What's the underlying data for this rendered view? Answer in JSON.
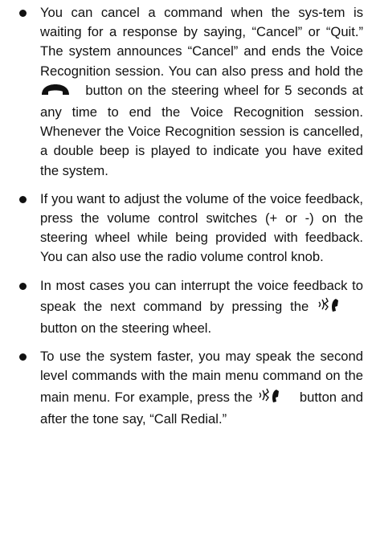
{
  "bullets": [
    {
      "a": "You can cancel a command when the sys-tem is waiting for a response by saying, “Cancel” or “Quit.” The system announces “Cancel” and ends the Voice Recognition session. You can also press and hold the",
      "icon": "phone-hang-up-icon",
      "b": "button on the steering wheel for 5 seconds at any time to end the Voice Recognition session. Whenever the Voice Recognition session is cancelled, a double beep is played to indicate you have exited the system."
    },
    {
      "a": "If you want to adjust the volume of the voice feedback, press the volume control switches (+ or -) on the steering wheel while being provided with feedback. You can also use the radio volume control knob."
    },
    {
      "a": "In most cases you can interrupt the voice feedback to speak the next command by pressing the",
      "icon": "talk-phone-icon",
      "b": "button on the steering wheel."
    },
    {
      "a": "To use the system faster, you may speak the second level commands with the main menu command on the main menu. For example, press the",
      "icon": "talk-phone-icon",
      "b": "button and after the tone say, “Call Redial.”"
    }
  ]
}
